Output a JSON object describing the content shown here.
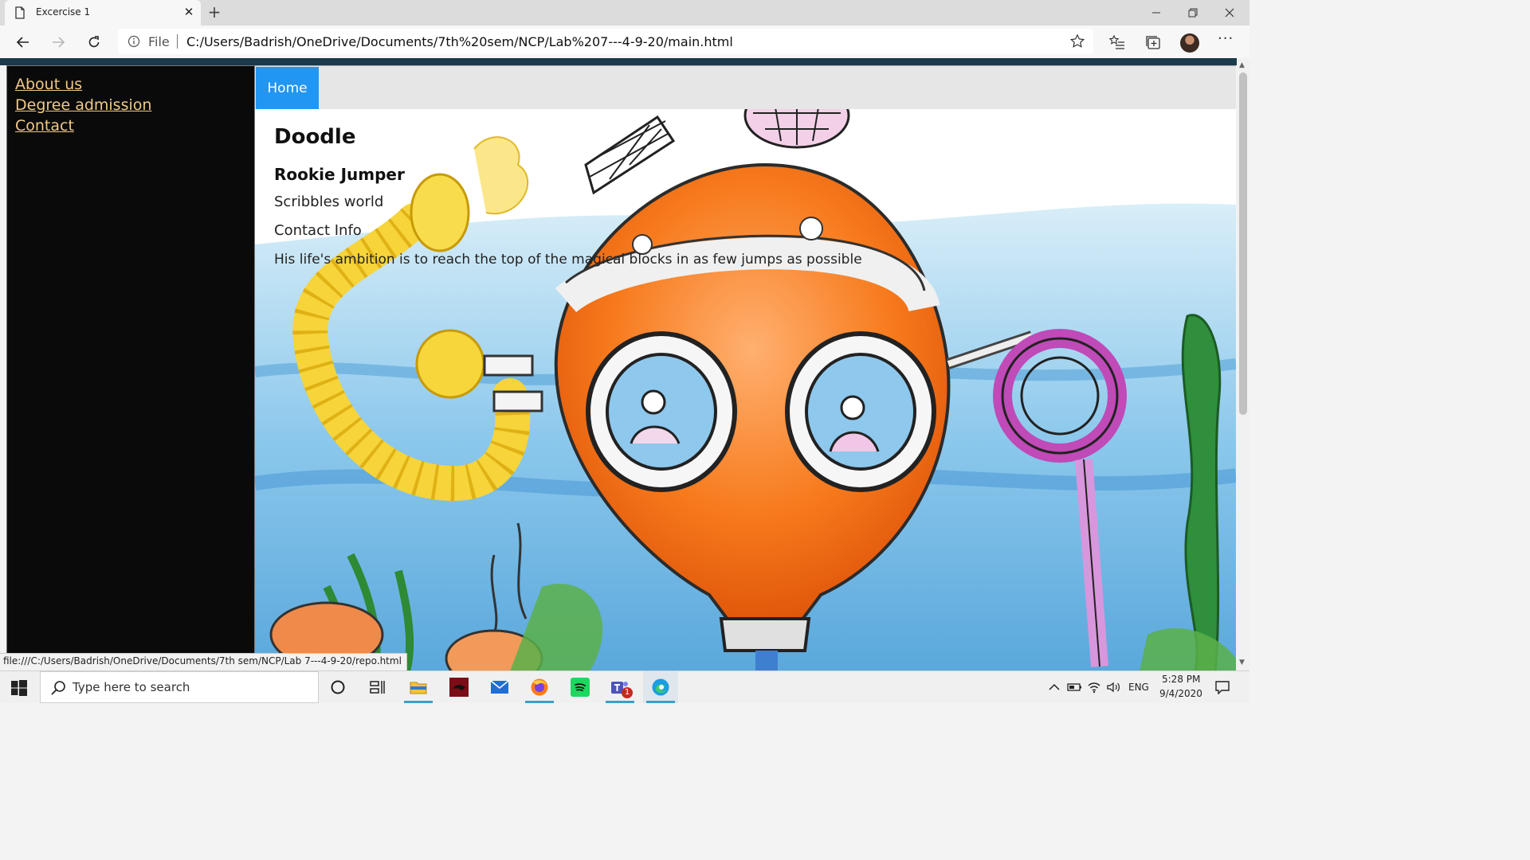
{
  "browser": {
    "tab_title": "Excercise 1",
    "tab_close": "✕",
    "new_tab": "+",
    "address_prefix": "File",
    "url": "C:/Users/Badrish/OneDrive/Documents/7th%20sem/NCP/Lab%207---4-9-20/main.html",
    "more": "···"
  },
  "sidebar": {
    "links": [
      "About us",
      "Degree admission",
      "Contact"
    ]
  },
  "navbar": {
    "home": "Home"
  },
  "content": {
    "title": "Doodle",
    "subtitle": "Rookie Jumper",
    "line1": "Scribbles world",
    "line2": "Contact Info",
    "line3": "His life's ambition is to reach the top of the magical blocks in as few jumps as possible"
  },
  "status_url": "file:///C:/Users/Badrish/OneDrive/Documents/7th sem/NCP/Lab 7---4-9-20/repo.html",
  "taskbar": {
    "search_placeholder": "Type here to search",
    "language": "ENG",
    "time": "5:28 PM",
    "date": "9/4/2020",
    "teams_badge": "1"
  },
  "colors": {
    "link": "#f0c987",
    "home_button": "#2196f3",
    "sidebar_bg": "#0a0a0a"
  }
}
